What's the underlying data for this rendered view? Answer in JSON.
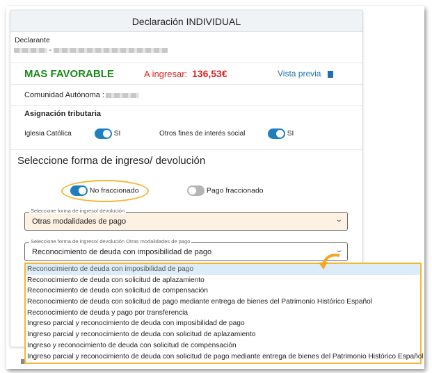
{
  "title": "Declaración INDIVIDUAL",
  "declarante_label": "Declarante",
  "result": {
    "status": "MAS FAVORABLE",
    "amount_label": "A ingresar:",
    "amount": "136,53€",
    "preview": "Vista previa"
  },
  "comunidad_label": "Comunidad Autónoma :",
  "asignacion": {
    "title": "Asignación tributaria",
    "iglesia": "Iglesia Católica",
    "iglesia_value": "SI",
    "otros": "Otros fines de interés social",
    "otros_value": "SI"
  },
  "section_title": "Seleccione forma de ingreso/ devolución",
  "options": {
    "no_fraccionado": "No fraccionado",
    "fraccionado": "Pago fraccionado"
  },
  "select1": {
    "legend": "Seleccione forma de ingreso/ devolución",
    "value": "Otras modalidades de pago"
  },
  "select2": {
    "legend": "Seleccione forma de ingreso/ devolución Otras modalidades de pago",
    "value": "Reconocimiento de deuda con imposibilidad de pago"
  },
  "dropdown": [
    "Reconocimiento de deuda con imposibilidad de pago",
    "Reconocimiento de deuda con solicitud de aplazamiento",
    "Reconocimiento de deuda con solicitud de compensación",
    "Reconocimiento de deuda con solicitud de pago mediante entrega de bienes del Patrimonio Histórico Español",
    "Reconocimiento de deuda y pago por transferencia",
    "Ingreso parcial y reconocimiento de deuda con imposibilidad de pago",
    "Ingreso parcial y reconocimiento de deuda con solicitud de aplazamiento",
    "Ingreso y reconocimiento de deuda con solicitud de compensación",
    "Ingreso parcial y reconocimiento de deuda con solicitud de pago mediante entrega de bienes del Patrimonio Histórico Español"
  ],
  "colors": {
    "favorable": "#1a8a1a",
    "amount": "#e02020",
    "link": "#1e6fb0",
    "toggle_on": "#1e7fc0",
    "highlight": "#f5b731"
  }
}
